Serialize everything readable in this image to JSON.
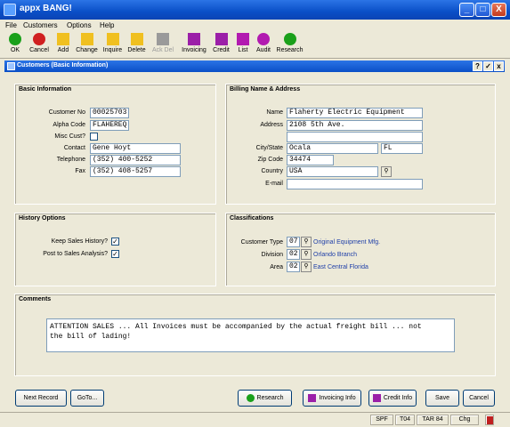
{
  "window": {
    "title": "appx BANG!",
    "min": "_",
    "max": "□",
    "close": "X"
  },
  "menu": [
    "File",
    "Customers",
    "Options",
    "Help"
  ],
  "toolbar": [
    {
      "label": "OK",
      "icon": "ok-icon",
      "color": "#1aa01a"
    },
    {
      "label": "Cancel",
      "icon": "cancel-icon",
      "color": "#d02020"
    },
    {
      "label": "Add",
      "icon": "add-folder-icon",
      "color": "#f0c020"
    },
    {
      "label": "Change",
      "icon": "change-folder-icon",
      "color": "#f0c020"
    },
    {
      "label": "Inquire",
      "icon": "inquire-folder-icon",
      "color": "#f0c020"
    },
    {
      "label": "Delete",
      "icon": "delete-folder-icon",
      "color": "#f0c020"
    },
    {
      "label": "Ack Del",
      "icon": "ack-delete-icon",
      "color": "#9a9a9a"
    },
    {
      "label": "Invoicing",
      "icon": "invoicing-icon",
      "color": "#9b1fa8"
    },
    {
      "label": "Credit",
      "icon": "credit-icon",
      "color": "#9b1fa8"
    },
    {
      "label": "List",
      "icon": "list-icon",
      "color": "#b21ab0"
    },
    {
      "label": "Audit",
      "icon": "audit-icon",
      "color": "#b21ab0"
    },
    {
      "label": "Research",
      "icon": "research-icon",
      "color": "#1aa01a"
    }
  ],
  "child": {
    "title": "Customers (Basic Information)",
    "help": "?",
    "check": "✓",
    "close": "x"
  },
  "basic": {
    "title": "Basic Information",
    "customer_no_label": "Customer No",
    "customer_no": "00025703",
    "alpha_code_label": "Alpha Code",
    "alpha_code": "FLAHEREQ",
    "misc_cust_label": "Misc Cust?",
    "contact_label": "Contact",
    "contact": "Gene Hoyt",
    "telephone_label": "Telephone",
    "telephone": "(352) 400-5252",
    "fax_label": "Fax",
    "fax": "(352) 408-5257"
  },
  "billing": {
    "title": "Billing Name & Address",
    "name_label": "Name",
    "name": "Flaherty Electric Equipment",
    "address_label": "Address",
    "address1": "2108 5th Ave.",
    "address2": "",
    "city_state_label": "City/State",
    "city": "Ocala",
    "state": "FL",
    "zip_label": "Zip Code",
    "zip": "34474",
    "country_label": "Country",
    "country": "USA",
    "email_label": "E-mail",
    "email": ""
  },
  "history": {
    "title": "History Options",
    "keep_label": "Keep Sales History?",
    "keep": "✓",
    "post_label": "Post to Sales Analysis?",
    "post": "✓"
  },
  "classifications": {
    "title": "Classifications",
    "type_label": "Customer Type",
    "type_code": "07",
    "type_desc": "Original Equipment Mfg.",
    "division_label": "Division",
    "division_code": "02",
    "division_desc": "Orlando Branch",
    "area_label": "Area",
    "area_code": "02",
    "area_desc": "East Central Florida"
  },
  "comments": {
    "title": "Comments",
    "line1": "ATTENTION SALES ... All Invoices must be accompanied by the actual freight bill ... not",
    "line2": "the bill of lading!"
  },
  "buttons": {
    "next_record": "Next Record",
    "goto": "GoTo...",
    "research": "Research",
    "invoicing_info": "Invoicing Info",
    "credit_info": "Credit Info",
    "save": "Save",
    "cancel": "Cancel"
  },
  "status": {
    "s1": "SPF",
    "s2": "T04",
    "s3": "TAR 84",
    "s4": "Chg"
  },
  "lookup_glyph": "⚲"
}
